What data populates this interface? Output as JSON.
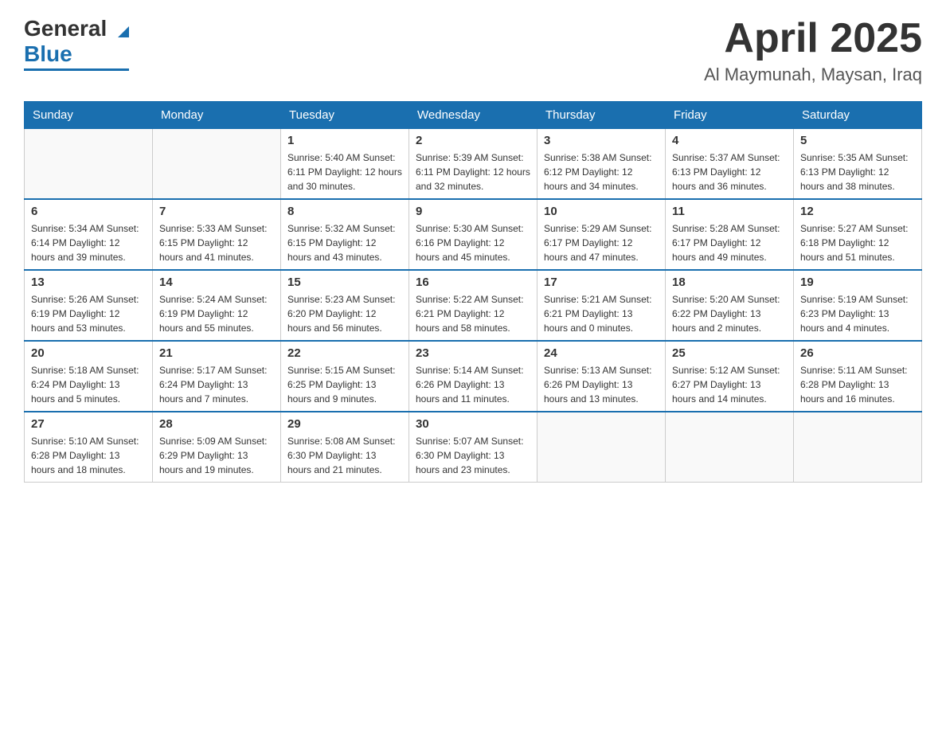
{
  "header": {
    "logo_general": "General",
    "logo_blue": "Blue",
    "title": "April 2025",
    "location": "Al Maymunah, Maysan, Iraq"
  },
  "days_of_week": [
    "Sunday",
    "Monday",
    "Tuesday",
    "Wednesday",
    "Thursday",
    "Friday",
    "Saturday"
  ],
  "weeks": [
    [
      {
        "day": "",
        "info": ""
      },
      {
        "day": "",
        "info": ""
      },
      {
        "day": "1",
        "info": "Sunrise: 5:40 AM\nSunset: 6:11 PM\nDaylight: 12 hours\nand 30 minutes."
      },
      {
        "day": "2",
        "info": "Sunrise: 5:39 AM\nSunset: 6:11 PM\nDaylight: 12 hours\nand 32 minutes."
      },
      {
        "day": "3",
        "info": "Sunrise: 5:38 AM\nSunset: 6:12 PM\nDaylight: 12 hours\nand 34 minutes."
      },
      {
        "day": "4",
        "info": "Sunrise: 5:37 AM\nSunset: 6:13 PM\nDaylight: 12 hours\nand 36 minutes."
      },
      {
        "day": "5",
        "info": "Sunrise: 5:35 AM\nSunset: 6:13 PM\nDaylight: 12 hours\nand 38 minutes."
      }
    ],
    [
      {
        "day": "6",
        "info": "Sunrise: 5:34 AM\nSunset: 6:14 PM\nDaylight: 12 hours\nand 39 minutes."
      },
      {
        "day": "7",
        "info": "Sunrise: 5:33 AM\nSunset: 6:15 PM\nDaylight: 12 hours\nand 41 minutes."
      },
      {
        "day": "8",
        "info": "Sunrise: 5:32 AM\nSunset: 6:15 PM\nDaylight: 12 hours\nand 43 minutes."
      },
      {
        "day": "9",
        "info": "Sunrise: 5:30 AM\nSunset: 6:16 PM\nDaylight: 12 hours\nand 45 minutes."
      },
      {
        "day": "10",
        "info": "Sunrise: 5:29 AM\nSunset: 6:17 PM\nDaylight: 12 hours\nand 47 minutes."
      },
      {
        "day": "11",
        "info": "Sunrise: 5:28 AM\nSunset: 6:17 PM\nDaylight: 12 hours\nand 49 minutes."
      },
      {
        "day": "12",
        "info": "Sunrise: 5:27 AM\nSunset: 6:18 PM\nDaylight: 12 hours\nand 51 minutes."
      }
    ],
    [
      {
        "day": "13",
        "info": "Sunrise: 5:26 AM\nSunset: 6:19 PM\nDaylight: 12 hours\nand 53 minutes."
      },
      {
        "day": "14",
        "info": "Sunrise: 5:24 AM\nSunset: 6:19 PM\nDaylight: 12 hours\nand 55 minutes."
      },
      {
        "day": "15",
        "info": "Sunrise: 5:23 AM\nSunset: 6:20 PM\nDaylight: 12 hours\nand 56 minutes."
      },
      {
        "day": "16",
        "info": "Sunrise: 5:22 AM\nSunset: 6:21 PM\nDaylight: 12 hours\nand 58 minutes."
      },
      {
        "day": "17",
        "info": "Sunrise: 5:21 AM\nSunset: 6:21 PM\nDaylight: 13 hours\nand 0 minutes."
      },
      {
        "day": "18",
        "info": "Sunrise: 5:20 AM\nSunset: 6:22 PM\nDaylight: 13 hours\nand 2 minutes."
      },
      {
        "day": "19",
        "info": "Sunrise: 5:19 AM\nSunset: 6:23 PM\nDaylight: 13 hours\nand 4 minutes."
      }
    ],
    [
      {
        "day": "20",
        "info": "Sunrise: 5:18 AM\nSunset: 6:24 PM\nDaylight: 13 hours\nand 5 minutes."
      },
      {
        "day": "21",
        "info": "Sunrise: 5:17 AM\nSunset: 6:24 PM\nDaylight: 13 hours\nand 7 minutes."
      },
      {
        "day": "22",
        "info": "Sunrise: 5:15 AM\nSunset: 6:25 PM\nDaylight: 13 hours\nand 9 minutes."
      },
      {
        "day": "23",
        "info": "Sunrise: 5:14 AM\nSunset: 6:26 PM\nDaylight: 13 hours\nand 11 minutes."
      },
      {
        "day": "24",
        "info": "Sunrise: 5:13 AM\nSunset: 6:26 PM\nDaylight: 13 hours\nand 13 minutes."
      },
      {
        "day": "25",
        "info": "Sunrise: 5:12 AM\nSunset: 6:27 PM\nDaylight: 13 hours\nand 14 minutes."
      },
      {
        "day": "26",
        "info": "Sunrise: 5:11 AM\nSunset: 6:28 PM\nDaylight: 13 hours\nand 16 minutes."
      }
    ],
    [
      {
        "day": "27",
        "info": "Sunrise: 5:10 AM\nSunset: 6:28 PM\nDaylight: 13 hours\nand 18 minutes."
      },
      {
        "day": "28",
        "info": "Sunrise: 5:09 AM\nSunset: 6:29 PM\nDaylight: 13 hours\nand 19 minutes."
      },
      {
        "day": "29",
        "info": "Sunrise: 5:08 AM\nSunset: 6:30 PM\nDaylight: 13 hours\nand 21 minutes."
      },
      {
        "day": "30",
        "info": "Sunrise: 5:07 AM\nSunset: 6:30 PM\nDaylight: 13 hours\nand 23 minutes."
      },
      {
        "day": "",
        "info": ""
      },
      {
        "day": "",
        "info": ""
      },
      {
        "day": "",
        "info": ""
      }
    ]
  ]
}
